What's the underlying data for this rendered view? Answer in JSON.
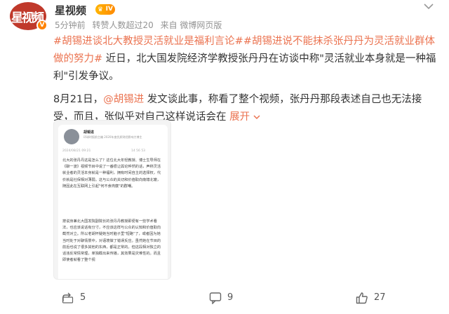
{
  "user": {
    "name": "星视频",
    "avatar_text": "星视频",
    "level": "IV",
    "meta": {
      "time": "5分钟前",
      "reposts": "转赞人数超过20",
      "source": "来自 微博网页版"
    }
  },
  "post": {
    "topic1": "#胡锡进谈北大教授灵活就业是福利言论#",
    "topic2": "#胡锡进说不能抹杀张丹丹为灵活就业群体做的努力#",
    "line1_rest": " 近日，北大国发院经济学教授张丹丹在访谈中称\"灵活就业本身就是一种福利\"引发争议。",
    "date": "8月21日，",
    "mention": "@胡锡进",
    "line2_rest": " 发文谈此事，称看了整个视频，张丹丹那段表述自己也无法接受，而且，张似乎对自己这样说话会在",
    "expand": "展开"
  },
  "screenshot": {
    "name": "胡锡进",
    "subtitle": "环球时报前主编 2020年度优质财经影响力博主",
    "meta": "2024/08/21 09:21",
    "stats": "14   56   53",
    "para1": "北大的张丹丹这是怎么了？这位北大年轻教授、博士生导师在《聊一波》视频节目中说了一番很让舆论哗然的话，声称灵活就业者的灵活本身就是一种福利，拥有时间自主的选择权，代价就是社保相对薄弱。这与公众的关切和价值取向南辕北辙，随因此在互联网上引起\"何不食肉糜\"的群嘲。",
    "para2": "按说身兼北大国发院副院长的张丹丹教授即便有一些学术看法，也应该说话有分寸，不应该这样与公众的认知和价值取向截然对立。所以老胡怀疑她当时脑子里\"短路\"了，或者因为她当时处于对聊情景中，对语境做了错误反应。虽然她在节目的前后也说了很多其他的东西，都是正常的。但这段相对独立的话违反常情常理，单独截出来传播，其效果是灾难性的。而且即使者就看了整个视"
  },
  "actions": {
    "share": "5",
    "comment": "9",
    "like": "27"
  }
}
